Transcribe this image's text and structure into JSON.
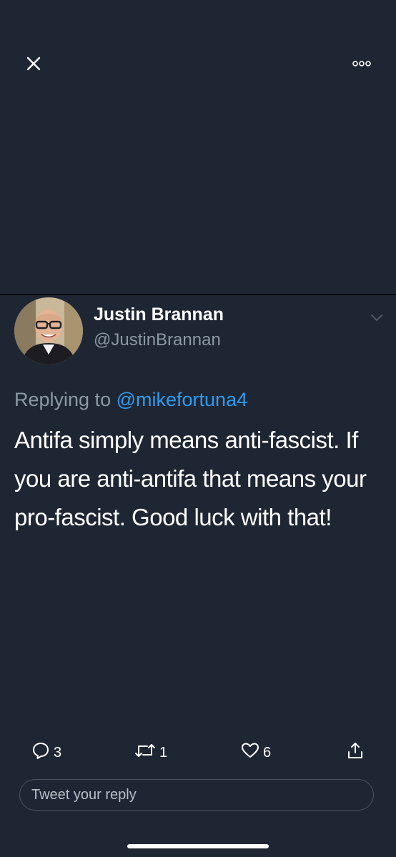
{
  "toolbar": {
    "close_icon": "close-icon",
    "more_icon": "more-options-icon"
  },
  "tweet": {
    "author_name": "Justin Brannan",
    "author_handle": "@JustinBrannan",
    "avatar_icon": "avatar",
    "replying_prefix": "Replying to",
    "replying_to": "@mikefortuna4",
    "text": "Antifa simply means anti-fascist. If you are anti-antifa that means your pro-fascist. Good luck with that!"
  },
  "actions": {
    "replies": "3",
    "retweets": "1",
    "likes": "6"
  },
  "reply_box": {
    "placeholder": "Tweet your reply"
  },
  "colors": {
    "background": "#1f2633",
    "mention": "#2f9bf0",
    "secondary_text": "#8b98a5"
  }
}
